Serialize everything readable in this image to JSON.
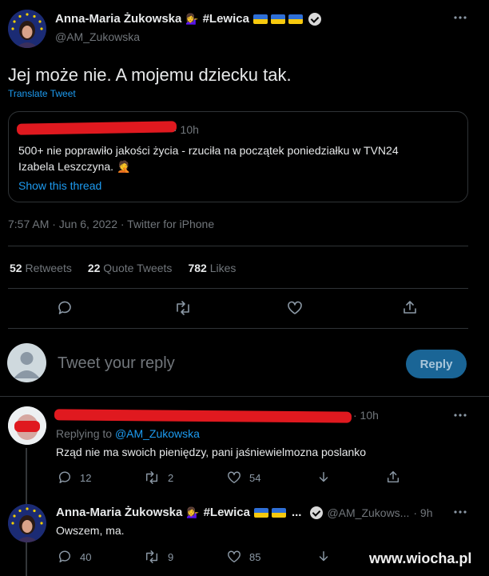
{
  "main_tweet": {
    "author_name": "Anna-Maria Żukowska",
    "tag": "#Lewica",
    "handle": "@AM_Zukowska",
    "text": "Jej może nie. A mojemu dziecku tak.",
    "translate": "Translate Tweet",
    "quote": {
      "time": "· 10h",
      "text_line1": "500+ nie poprawiło jakości życia - rzuciła na początek poniedziałku w TVN24",
      "text_line2": "Izabela Leszczyna. 🤦",
      "show_thread": "Show this thread"
    },
    "timestamp": "7:57 AM · Jun 6, 2022 · Twitter for iPhone",
    "stats": {
      "retweets_count": "52",
      "retweets_label": "Retweets",
      "quotes_count": "22",
      "quotes_label": "Quote Tweets",
      "likes_count": "782",
      "likes_label": "Likes"
    }
  },
  "reply_box": {
    "placeholder": "Tweet your reply",
    "button": "Reply"
  },
  "reply1": {
    "time": "· 10h",
    "replying_prefix": "Replying to",
    "replying_handle": "@AM_Zukowska",
    "text": "Rząd nie ma swoich pieniędzy, pani jaśniewielmozna poslanko",
    "replies": "12",
    "retweets": "2",
    "likes": "54"
  },
  "reply2": {
    "author_name": "Anna-Maria Żukowska",
    "tag": "#Lewica",
    "ellipsis": "...",
    "handle": "@AM_Zukows...",
    "time": "· 9h",
    "text": "Owszem, ma.",
    "replies": "40",
    "retweets": "9",
    "likes": "85"
  },
  "watermark": "www.wiocha.pl",
  "colors": {
    "accent": "#1d9bf0",
    "redaction": "#e0191f",
    "flag_blue": "#2f6fd6",
    "flag_yellow": "#f6c90e"
  }
}
